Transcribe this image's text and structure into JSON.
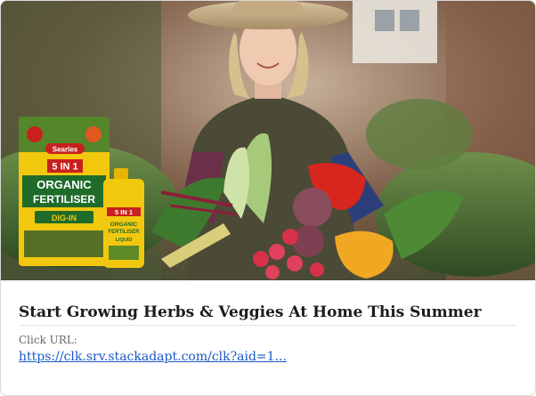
{
  "ad": {
    "headline": "Start Growing Herbs & Veggies At Home This Summer",
    "click_url_label": "Click URL:",
    "click_url": "https://clk.srv.stackadapt.com/clk?aid=1..."
  },
  "product": {
    "brand": "Searles",
    "bag_badge": "5 IN 1",
    "bag_line1": "ORGANIC",
    "bag_line2": "FERTILISER",
    "bag_sub": "DIG-IN",
    "bottle_badge": "5 IN 1",
    "bottle_line1": "ORGANIC",
    "bottle_line2": "FERTILISER",
    "bottle_sub": "LIQUID"
  },
  "colors": {
    "headline": "#1c1c1c",
    "label": "#666666",
    "link": "#1a58c8",
    "bag_yellow": "#f2c80f",
    "bag_red": "#c8201e",
    "bag_green": "#1f6b2a"
  }
}
